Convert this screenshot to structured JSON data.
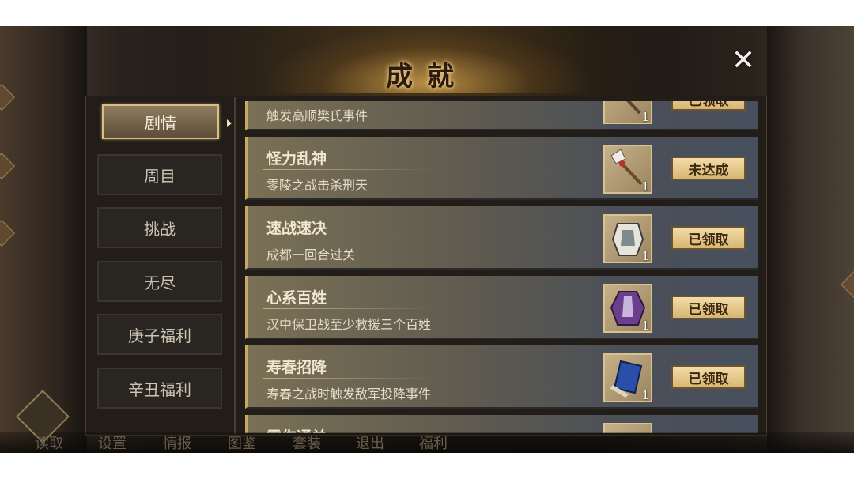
{
  "title": "成就",
  "close_label": "✕",
  "tabs": [
    {
      "label": "剧情",
      "active": true
    },
    {
      "label": "周目",
      "active": false
    },
    {
      "label": "挑战",
      "active": false
    },
    {
      "label": "无尽",
      "active": false
    },
    {
      "label": "庚子福利",
      "active": false
    },
    {
      "label": "辛丑福利",
      "active": false
    }
  ],
  "achievements": [
    {
      "title": "",
      "desc": "触发高顺樊氏事件",
      "reward_icon": "axe-icon",
      "reward_count": "1",
      "status": "已领取"
    },
    {
      "title": "怪力乱神",
      "desc": "零陵之战击杀刑天",
      "reward_icon": "axe-icon",
      "reward_count": "1",
      "status": "未达成"
    },
    {
      "title": "速战速决",
      "desc": "成都一回合过关",
      "reward_icon": "armor-white-icon",
      "reward_count": "1",
      "status": "已领取"
    },
    {
      "title": "心系百姓",
      "desc": "汉中保卫战至少救援三个百姓",
      "reward_icon": "robe-purple-icon",
      "reward_count": "1",
      "status": "已领取"
    },
    {
      "title": "寿春招降",
      "desc": "寿春之战时触发敌军投降事件",
      "reward_icon": "book-icon",
      "reward_count": "1",
      "status": "已领取"
    },
    {
      "title": "零伤通关",
      "desc": "",
      "reward_icon": "axe-icon",
      "reward_count": "",
      "status": ""
    }
  ],
  "bottom_menu": [
    "读取",
    "设置",
    "情报",
    "图鉴",
    "套装",
    "退出",
    "福利"
  ],
  "colors": {
    "accent_gold": "#d9bf84",
    "button_face": "#f3dca8",
    "card_base": "#5e5a50"
  }
}
